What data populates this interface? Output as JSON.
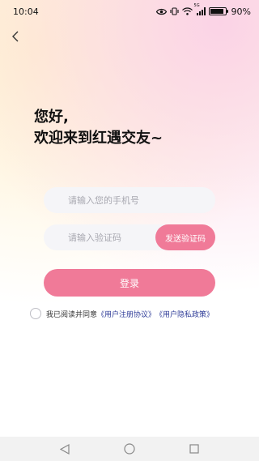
{
  "status_bar": {
    "time": "10:04",
    "network_label": "5G",
    "battery": "90%",
    "battery_level": 0.9
  },
  "header": {
    "back_icon": "back-chevron-icon"
  },
  "welcome": {
    "line1": "您好,",
    "line2": "欢迎来到红遇交友~"
  },
  "form": {
    "phone_placeholder": "请输入您的手机号",
    "code_placeholder": "请输入验证码",
    "send_code_label": "发送验证码",
    "login_label": "登录"
  },
  "agreement": {
    "prefix": "我已阅读并同意",
    "user_agreement": "《用户注册协议》",
    "privacy_policy": "《用户隐私政策》"
  },
  "nav": {
    "back_icon": "nav-back-icon",
    "home_icon": "nav-home-icon",
    "recents_icon": "nav-recents-icon"
  },
  "colors": {
    "accent": "#f07a98",
    "link": "#2f3c98"
  }
}
